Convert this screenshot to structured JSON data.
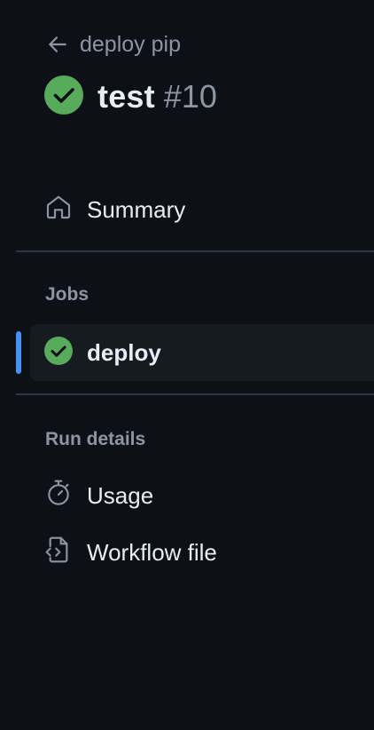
{
  "header": {
    "back_label": "deploy pip",
    "run_name": "test",
    "run_number": "#10",
    "status": "success"
  },
  "nav": {
    "summary_label": "Summary"
  },
  "jobs": {
    "heading": "Jobs",
    "items": [
      {
        "label": "deploy",
        "status": "success",
        "selected": true
      }
    ]
  },
  "run_details": {
    "heading": "Run details",
    "items": [
      {
        "label": "Usage",
        "icon": "stopwatch-icon"
      },
      {
        "label": "Workflow file",
        "icon": "file-code-icon"
      }
    ]
  },
  "colors": {
    "background": "#0d1117",
    "success": "#57ab5a",
    "accent": "#4493f8",
    "muted": "#8d96a0",
    "text": "#e6edf3",
    "selected_bg": "#161b22"
  }
}
